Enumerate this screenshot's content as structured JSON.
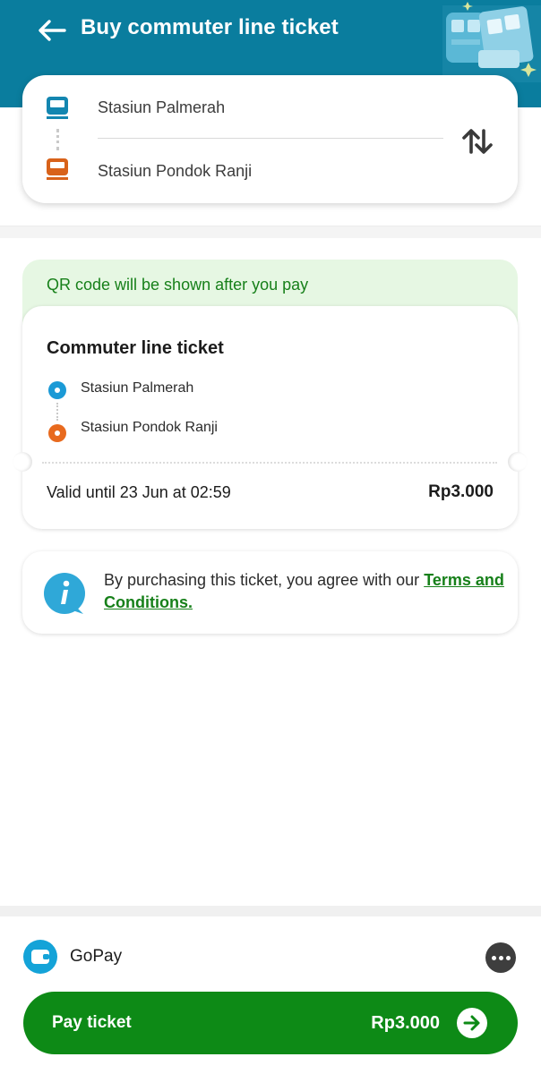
{
  "header": {
    "title": "Buy commuter line ticket"
  },
  "route": {
    "from_station": "Stasiun Palmerah",
    "to_station": "Stasiun Pondok Ranji"
  },
  "qr_notice": "QR code will be shown after you pay",
  "ticket": {
    "title": "Commuter line ticket",
    "from_station": "Stasiun Palmerah",
    "to_station": "Stasiun Pondok Ranji",
    "valid_until": "Valid until 23 Jun at 02:59",
    "price": "Rp3.000"
  },
  "terms": {
    "prefix": "By purchasing this ticket, you agree with our ",
    "link": "Terms and Conditions."
  },
  "payment": {
    "method": "GoPay",
    "pay_label": "Pay ticket",
    "pay_amount": "Rp3.000"
  },
  "colors": {
    "header": "#0a7d9e",
    "accent_green": "#0d8a16",
    "from_station": "#1b9ad6",
    "to_station": "#e86a1e"
  },
  "icons": [
    "back-arrow-icon",
    "train-illustration-icon",
    "train-from-icon",
    "train-to-icon",
    "swap-icon",
    "info-icon",
    "gopay-wallet-icon",
    "more-icon",
    "arrow-right-icon"
  ]
}
